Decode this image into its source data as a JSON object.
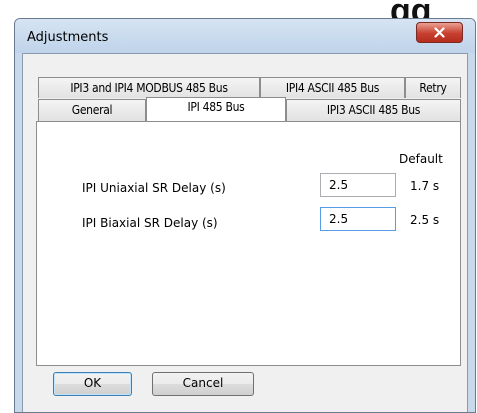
{
  "background": {
    "heading_fragment": "gg"
  },
  "window": {
    "title": "Adjustments"
  },
  "tabs": {
    "row_back": [
      {
        "label": "IPI3 and IPI4 MODBUS 485 Bus"
      },
      {
        "label": "IPI4 ASCII 485 Bus"
      },
      {
        "label": "Retry"
      }
    ],
    "row_front": [
      {
        "label": "General"
      },
      {
        "label": "IPI 485 Bus",
        "active": true
      },
      {
        "label": "IPI3 ASCII 485 Bus"
      }
    ]
  },
  "panel": {
    "default_header": "Default",
    "rows": [
      {
        "label": "IPI Uniaxial SR Delay (s)",
        "value": "2.5",
        "default": "1.7 s"
      },
      {
        "label": "IPI Biaxial SR Delay (s)",
        "value": "2.5",
        "default": "2.5 s"
      }
    ]
  },
  "buttons": {
    "ok": "OK",
    "cancel": "Cancel"
  },
  "icons": {
    "close": "close-icon"
  },
  "colors": {
    "close_button": "#c7402f",
    "frame": "#c8d9ec",
    "focus_border": "#569de5"
  }
}
